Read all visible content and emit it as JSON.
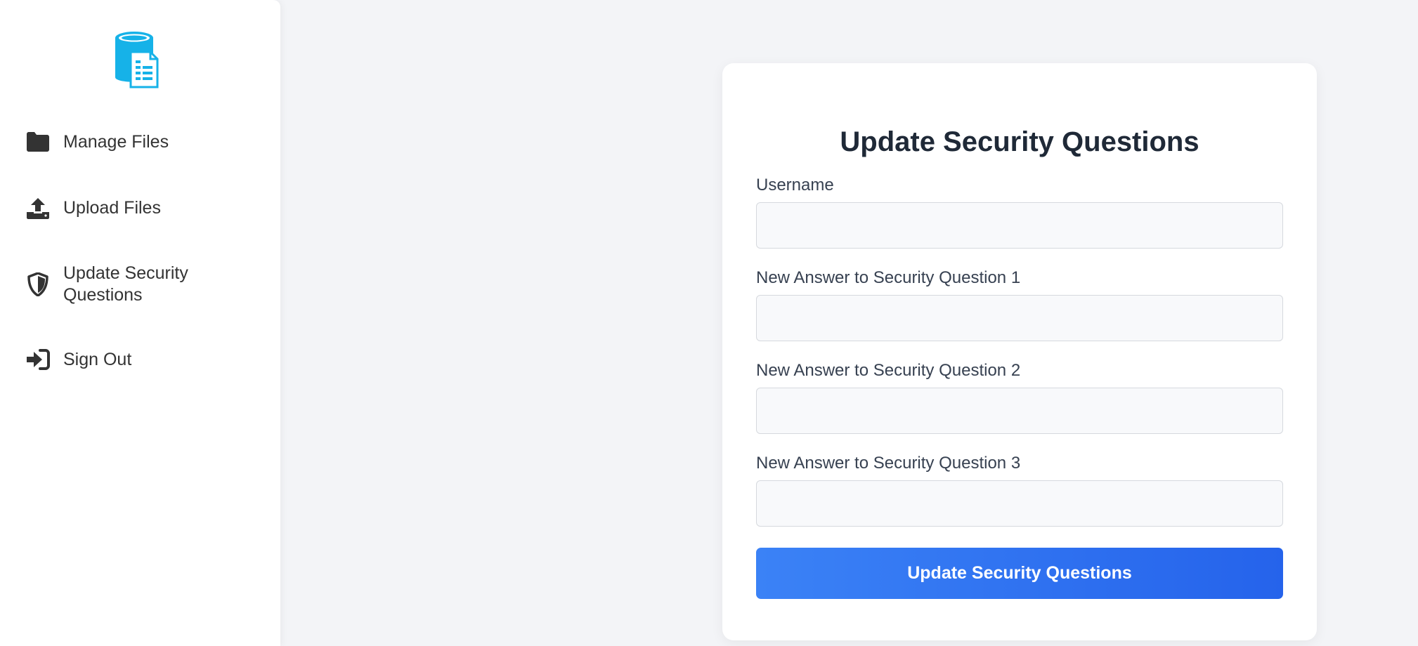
{
  "brand": {
    "logo_icon": "database-document-icon",
    "accent_color": "#16b2e8"
  },
  "sidebar": {
    "items": [
      {
        "label": "Manage Files",
        "icon": "folder-icon"
      },
      {
        "label": "Upload Files",
        "icon": "upload-icon"
      },
      {
        "label": "Update Security Questions",
        "icon": "shield-icon"
      },
      {
        "label": "Sign Out",
        "icon": "sign-out-icon"
      }
    ]
  },
  "form": {
    "title": "Update Security Questions",
    "fields": [
      {
        "label": "Username",
        "value": "",
        "placeholder": ""
      },
      {
        "label": "New Answer to Security Question 1",
        "value": "",
        "placeholder": ""
      },
      {
        "label": "New Answer to Security Question 2",
        "value": "",
        "placeholder": ""
      },
      {
        "label": "New Answer to Security Question 3",
        "value": "",
        "placeholder": ""
      }
    ],
    "submit_label": "Update Security Questions",
    "button_color": "#3b82f6"
  }
}
